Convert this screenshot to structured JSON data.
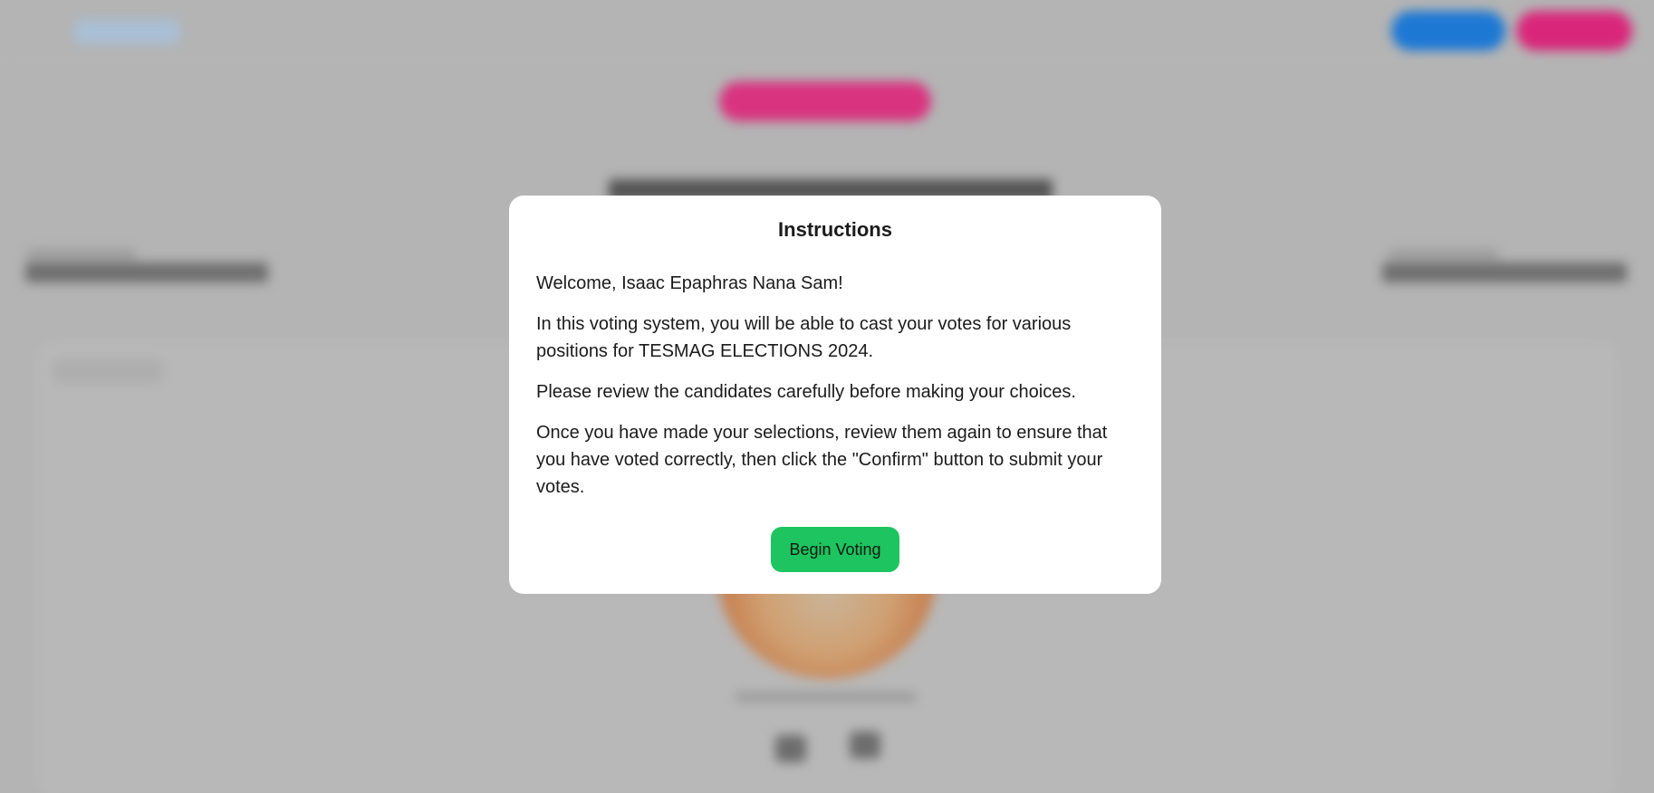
{
  "modal": {
    "title": "Instructions",
    "greeting": "Welcome, Isaac Epaphras Nana Sam!",
    "paragraphs": [
      "In this voting system, you will be able to cast your votes for various positions for TESMAG ELECTIONS 2024.",
      "Please review the candidates carefully before making your choices.",
      "Once you have made your selections, review them again to ensure that you have voted correctly, then click the \"Confirm\" button to submit your votes."
    ],
    "begin_button_label": "Begin Voting"
  },
  "colors": {
    "overlay": "#b4b4b4",
    "primary_blue": "#1d78d4",
    "accent_pink": "#d9267a",
    "begin_button": "#1dc45f",
    "modal_bg": "#ffffff"
  }
}
